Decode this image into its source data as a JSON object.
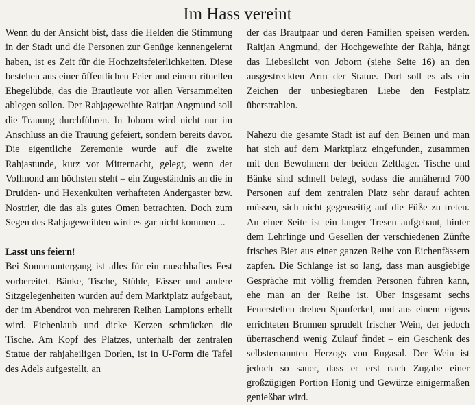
{
  "title": "Im Hass vereint",
  "left": {
    "p1": "Wenn du der Ansicht bist, dass die Helden die Stimmung in der Stadt und die Personen zur Genüge kennengelernt haben, ist es Zeit für die Hochzeitsfeierlichkeiten. Diese bestehen aus einer öffentlichen Feier und einem rituellen Ehegelübde, das die Brautleute vor allen Versammelten ablegen sollen. Der Rahjageweihte Raitjan Angmund soll die Trauung durchführen. In Joborn wird nicht nur im Anschluss an die Trauung gefeiert, sondern bereits davor. Die eigentliche Zeremonie wurde auf die zweite Rahjastunde, kurz vor Mitternacht, gelegt, wenn der Vollmond am höchsten steht – ein Zugeständnis an die in Druiden- und Hexenkulten verhafteten Andergaster bzw. Nostrier, die das als gutes Omen betrachten. Doch zum Segen des Rahjageweihten wird es gar nicht kommen ...",
    "heading": "Lasst uns feiern!",
    "p2": "Bei Sonnenuntergang ist alles für ein rauschhaftes Fest vorbereitet. Bänke, Tische, Stühle, Fässer und andere Sitzgelegenheiten wurden auf dem Marktplatz aufgebaut, der im Abendrot von mehreren Reihen Lampions erhellt wird. Eichenlaub und dicke Kerzen schmücken die Tische. Am Kopf des Platzes, unterhalb der zentralen Statue der rahjaheiligen Dorlen, ist in U-Form die Tafel des Adels aufgestellt, an"
  },
  "right": {
    "p1_before": "der das Brautpaar und deren Familien speisen werden. Raitjan Angmund, der Hochgeweihte der Rahja, hängt das Liebeslicht von Joborn (siehe Seite ",
    "p1_page": "16",
    "p1_after": ") an den ausgestreckten Arm der Statue. Dort soll es als ein Zeichen der unbesiegbaren Liebe den Festplatz überstrahlen.",
    "p2": "Nahezu die gesamte Stadt ist auf den Beinen und man hat sich auf dem Marktplatz eingefunden, zusammen mit den Bewohnern der beiden Zeltlager. Tische und Bänke sind schnell belegt, sodass die annähernd 700 Personen auf dem zentralen Platz sehr darauf achten müssen, sich nicht gegenseitig auf die Füße zu treten. An einer Seite ist ein langer Tresen aufgebaut, hinter dem Lehrlinge und Gesellen der verschiedenen Zünfte frisches Bier aus einer ganzen Reihe von Eichenfässern zapfen. Die Schlange ist so lang, dass man ausgiebige Gespräche mit völlig fremden Personen führen kann, ehe man an der Reihe ist. Über insgesamt sechs Feuerstellen drehen Spanferkel, und aus einem eigens errichteten Brunnen sprudelt frischer Wein, der jedoch überraschend wenig Zulauf findet – ein Geschenk des selbsternannten Herzogs von Engasal. Der Wein ist jedoch so sauer, dass er erst nach Zugabe einer großzügigen Portion Honig und Gewürze einigermaßen genießbar wird."
  }
}
